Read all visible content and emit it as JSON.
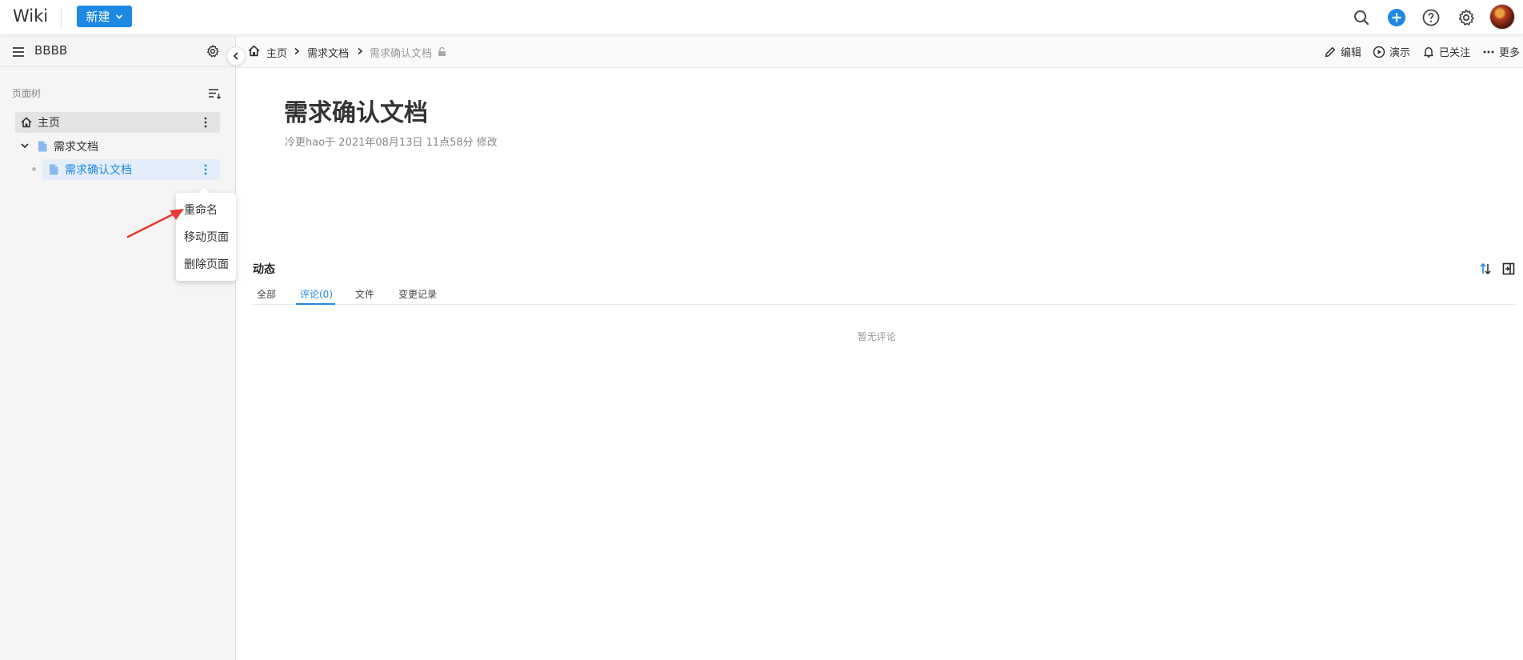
{
  "app": {
    "title": "Wiki",
    "new_button": "新建"
  },
  "sidebar": {
    "space_name": "BBBB",
    "section_label": "页面树",
    "tree": {
      "home": "主页",
      "req_docs": "需求文档",
      "req_confirm_doc": "需求确认文档"
    }
  },
  "context_menu": {
    "items": [
      "重命名",
      "移动页面",
      "删除页面"
    ]
  },
  "breadcrumb": {
    "home": "主页",
    "parent": "需求文档",
    "current": "需求确认文档"
  },
  "actions": {
    "edit": "编辑",
    "present": "演示",
    "following": "已关注",
    "more": "更多"
  },
  "page": {
    "title": "需求确认文档",
    "meta": "冷更hao于 2021年08月13日 11点58分 修改"
  },
  "activity": {
    "title": "动态",
    "tabs": [
      "全部",
      "评论(0)",
      "文件",
      "变更记录"
    ],
    "active_tab": "评论(0)",
    "empty": "暂无评论"
  },
  "colors": {
    "accent": "#1e88e5",
    "annotation_arrow": "#e53935"
  },
  "icons": [
    "search-icon",
    "add-circle-icon",
    "help-icon",
    "settings-icon",
    "menu-icon",
    "gear-icon",
    "sort-icon",
    "chevron-left-icon",
    "home-icon",
    "document-icon",
    "more-vertical-icon",
    "chevron-down-icon",
    "lock-icon",
    "edit-icon",
    "play-icon",
    "bell-icon",
    "more-horizontal-icon",
    "sort-arrows-icon",
    "panel-icon"
  ]
}
